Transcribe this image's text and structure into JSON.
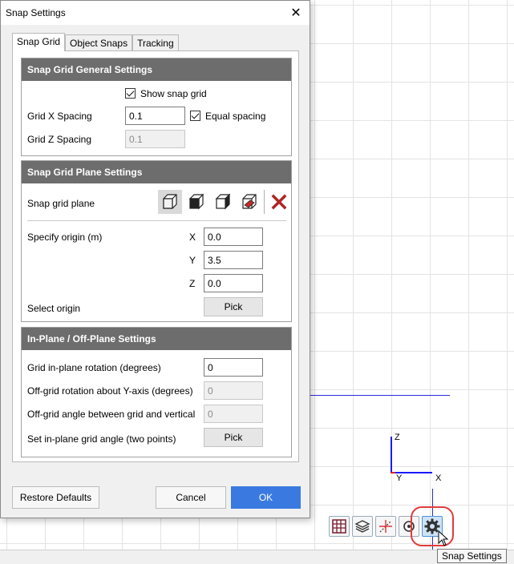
{
  "dialog": {
    "title": "Snap Settings",
    "close_glyph": "✕",
    "tabs": [
      {
        "label": "Snap Grid",
        "active": true
      },
      {
        "label": "Object Snaps",
        "active": false
      },
      {
        "label": "Tracking",
        "active": false
      }
    ],
    "general": {
      "header": "Snap Grid General Settings",
      "show_snap_grid_label": "Show snap grid",
      "show_snap_grid": true,
      "grid_x_label": "Grid X Spacing",
      "grid_x_value": "0.1",
      "equal_spacing_label": "Equal spacing",
      "equal_spacing": true,
      "grid_z_label": "Grid Z Spacing",
      "grid_z_value": "0.1"
    },
    "plane": {
      "header": "Snap Grid Plane Settings",
      "snap_grid_plane_label": "Snap grid plane",
      "specify_origin_label": "Specify origin (m)",
      "x_label": "X",
      "x_value": "0.0",
      "y_label": "Y",
      "y_value": "3.5",
      "z_label": "Z",
      "z_value": "0.0",
      "select_origin_label": "Select origin",
      "pick_label": "Pick"
    },
    "inplane": {
      "header": "In-Plane / Off-Plane Settings",
      "rotation_label": "Grid in-plane rotation (degrees)",
      "rotation_value": "0",
      "offgrid_y_label": "Off-grid rotation about Y-axis (degrees)",
      "offgrid_y_value": "0",
      "offgrid_angle_label": "Off-grid angle between grid and vertical",
      "offgrid_angle_value": "0",
      "set_angle_label": "Set in-plane grid angle (two points)",
      "pick_label": "Pick"
    },
    "buttons": {
      "restore": "Restore Defaults",
      "cancel": "Cancel",
      "ok": "OK"
    }
  },
  "viewport": {
    "axis_z": "Z",
    "axis_y": "Y",
    "axis_x": "X",
    "tooltip": "Snap Settings"
  },
  "colors": {
    "accent": "#3a7ae0",
    "header": "#6d6d6d",
    "highlight": "#e23a3a",
    "axis": "#1a1aff"
  }
}
